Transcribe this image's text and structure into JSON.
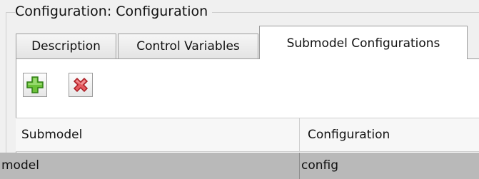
{
  "group": {
    "title": "Configuration: Configuration"
  },
  "tabs": [
    {
      "label": "Description",
      "active": false
    },
    {
      "label": "Control Variables",
      "active": false
    },
    {
      "label": "Submodel Configurations",
      "active": true
    }
  ],
  "toolbar": {
    "add_icon": "plus-icon",
    "remove_icon": "x-icon"
  },
  "table": {
    "columns": [
      "Submodel",
      "Configuration"
    ],
    "rows": [
      {
        "submodel": "model",
        "configuration": "config",
        "selected": true
      }
    ]
  },
  "colors": {
    "add_green": "#5db233",
    "remove_red": "#e0444a",
    "selected_row": "#b9b9b9"
  }
}
